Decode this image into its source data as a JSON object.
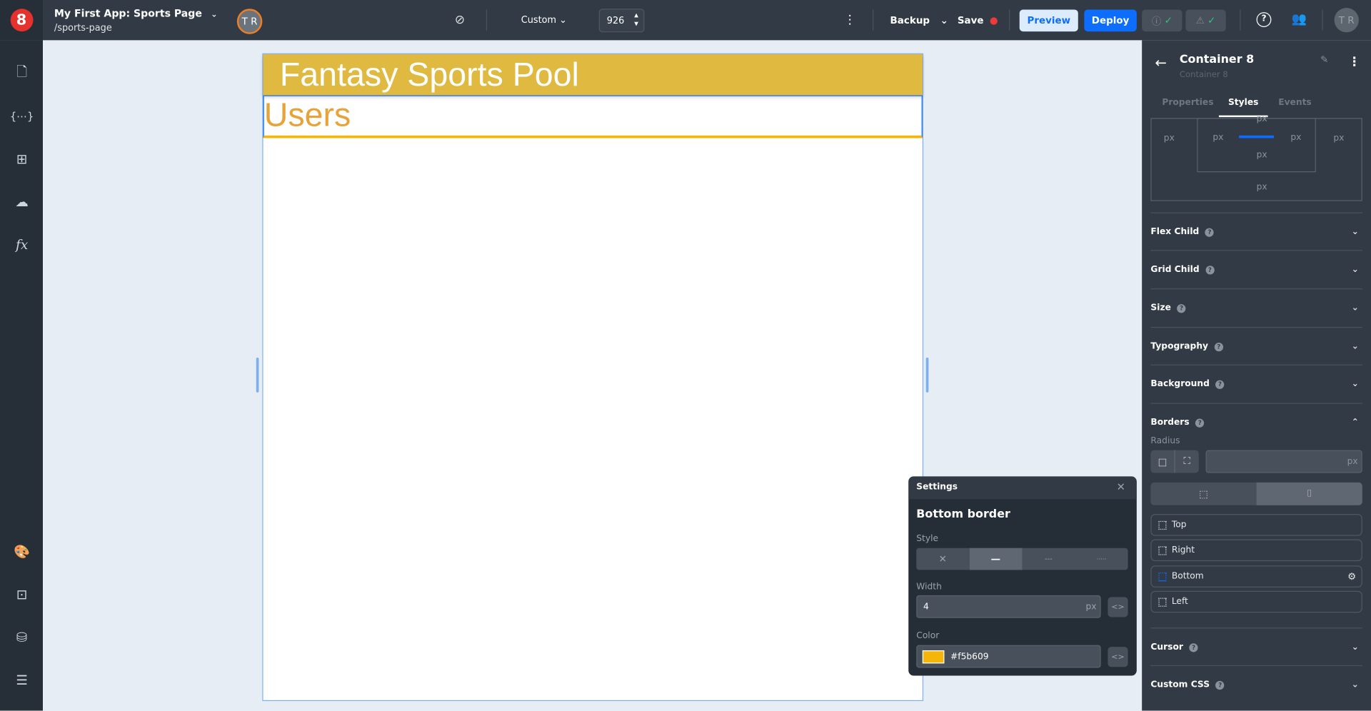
{
  "app": {
    "title": "My First App: Sports Page",
    "path": "/sports-page",
    "logo": "8",
    "avatar_initials": "T R"
  },
  "toolbar": {
    "viewport": "Custom",
    "width_value": "926",
    "backup": "Backup",
    "save": "Save",
    "preview": "Preview",
    "deploy": "Deploy",
    "user_initials": "T R"
  },
  "canvas": {
    "header_title": "Fantasy Sports Pool",
    "users_heading": "Users",
    "header_color": "#e0b941",
    "users_color": "#e7a33a"
  },
  "panel": {
    "title": "Container 8",
    "subtitle": "Container 8",
    "tabs": [
      "Properties",
      "Styles",
      "Events"
    ],
    "active_tab": "Styles",
    "px": "px",
    "sections": [
      "Flex Child",
      "Grid Child",
      "Size",
      "Typography",
      "Background",
      "Borders",
      "Cursor",
      "Custom CSS"
    ],
    "radius_label": "Radius",
    "sides": [
      "Top",
      "Right",
      "Bottom",
      "Left"
    ]
  },
  "settings": {
    "title": "Settings",
    "heading": "Bottom border",
    "style_label": "Style",
    "width_label": "Width",
    "width_value": "4",
    "width_unit": "px",
    "color_label": "Color",
    "color_value": "#f5b609"
  }
}
